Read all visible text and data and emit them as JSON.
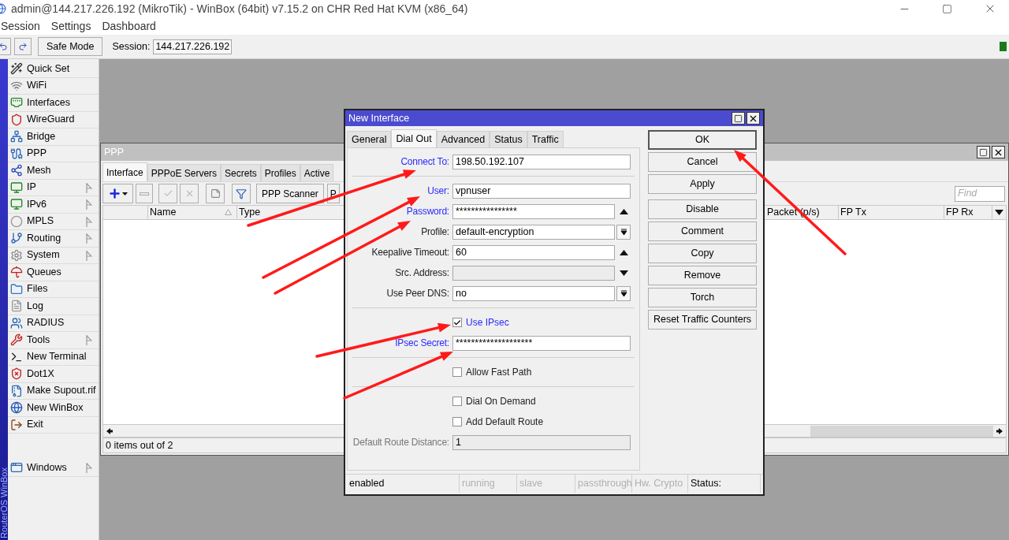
{
  "window": {
    "title": "admin@144.217.226.192 (MikroTik) - WinBox (64bit) v7.15.2 on CHR Red Hat KVM (x86_64)"
  },
  "menu": [
    "Session",
    "Settings",
    "Dashboard"
  ],
  "toolbar": {
    "safe_mode": "Safe Mode",
    "session_label": "Session:",
    "session_value": "144.217.226.192"
  },
  "side_banner": "RouterOS WinBox",
  "sidebar": {
    "items": [
      {
        "label": "Quick Set",
        "submenu": false
      },
      {
        "label": "WiFi",
        "submenu": false
      },
      {
        "label": "Interfaces",
        "submenu": false
      },
      {
        "label": "WireGuard",
        "submenu": false
      },
      {
        "label": "Bridge",
        "submenu": false
      },
      {
        "label": "PPP",
        "submenu": false
      },
      {
        "label": "Mesh",
        "submenu": false
      },
      {
        "label": "IP",
        "submenu": true
      },
      {
        "label": "IPv6",
        "submenu": true
      },
      {
        "label": "MPLS",
        "submenu": true
      },
      {
        "label": "Routing",
        "submenu": true
      },
      {
        "label": "System",
        "submenu": true
      },
      {
        "label": "Queues",
        "submenu": false
      },
      {
        "label": "Files",
        "submenu": false
      },
      {
        "label": "Log",
        "submenu": false
      },
      {
        "label": "RADIUS",
        "submenu": false
      },
      {
        "label": "Tools",
        "submenu": true
      },
      {
        "label": "New Terminal",
        "submenu": false
      },
      {
        "label": "Dot1X",
        "submenu": false
      },
      {
        "label": "Make Supout.rif",
        "submenu": false
      },
      {
        "label": "New WinBox",
        "submenu": false
      },
      {
        "label": "Exit",
        "submenu": false
      }
    ],
    "bottom_items": [
      {
        "label": "Windows",
        "submenu": true
      }
    ]
  },
  "ppp_window": {
    "title": "PPP",
    "tabs": [
      {
        "label": "Interface",
        "selected": true
      },
      {
        "label": "PPPoE Servers",
        "selected": false
      },
      {
        "label": "Secrets",
        "selected": false
      },
      {
        "label": "Profiles",
        "selected": false
      },
      {
        "label": "Active",
        "selected": false
      }
    ],
    "toolbar_buttons": [
      "PPP Scanner",
      "P"
    ],
    "find": {
      "placeholder": "Find"
    },
    "columns": [
      {
        "label": "Name",
        "sorted": true
      },
      {
        "label": "Type",
        "sorted": false
      },
      {
        "label": "Packet (p/s)",
        "sorted": false
      },
      {
        "label": "FP Tx",
        "sorted": false
      },
      {
        "label": "FP Rx",
        "sorted": false
      }
    ],
    "status": "0 items out of 2"
  },
  "dialog": {
    "title": "New Interface",
    "tabs": [
      {
        "label": "General",
        "selected": false
      },
      {
        "label": "Dial Out",
        "selected": true
      },
      {
        "label": "Advanced",
        "selected": false
      },
      {
        "label": "Status",
        "selected": false
      },
      {
        "label": "Traffic",
        "selected": false
      }
    ],
    "fields": [
      {
        "kind": "field",
        "label": "Connect To:",
        "value": "198.50.192.107",
        "highlighted": true,
        "disabled": false
      },
      {
        "kind": "separator"
      },
      {
        "kind": "field",
        "label": "User:",
        "value": "vpnuser",
        "highlighted": true,
        "disabled": false
      },
      {
        "kind": "collapsible_field",
        "label": "Password:",
        "value": "****************",
        "highlighted": true,
        "disabled": false
      },
      {
        "kind": "dropdown_field",
        "label": "Profile:",
        "value": "default-encryption",
        "highlighted": false,
        "disabled": false
      },
      {
        "kind": "collapsible_field",
        "label": "Keepalive Timeout:",
        "value": "60",
        "highlighted": false,
        "disabled": false
      },
      {
        "kind": "expandable_field",
        "label": "Src. Address:",
        "highlighted": false,
        "disabled": true
      },
      {
        "kind": "dropdown_field",
        "label": "Use Peer DNS:",
        "value": "no",
        "highlighted": false,
        "disabled": false
      },
      {
        "kind": "separator"
      },
      {
        "kind": "checkbox",
        "label": "Use IPsec",
        "checked": true,
        "highlighted": true
      },
      {
        "kind": "field",
        "label": "IPsec Secret:",
        "value": "********************",
        "highlighted": true,
        "disabled": false
      },
      {
        "kind": "separator"
      },
      {
        "kind": "checkbox",
        "label": "Allow Fast Path",
        "checked": false,
        "highlighted": false
      },
      {
        "kind": "separator"
      },
      {
        "kind": "checkbox",
        "label": "Dial On Demand",
        "checked": false,
        "highlighted": false
      },
      {
        "kind": "checkbox",
        "label": "Add Default Route",
        "checked": false,
        "highlighted": false
      },
      {
        "kind": "field",
        "label": "Default Route Distance:",
        "value": "1",
        "highlighted": false,
        "disabled": true
      }
    ],
    "button_groups": [
      [
        {
          "label": "OK",
          "default": true
        },
        {
          "label": "Cancel",
          "default": false
        },
        {
          "label": "Apply",
          "default": false
        }
      ],
      [
        {
          "label": "Disable",
          "default": false
        },
        {
          "label": "Comment",
          "default": false
        },
        {
          "label": "Copy",
          "default": false
        },
        {
          "label": "Remove",
          "default": false
        },
        {
          "label": "Torch",
          "default": false
        },
        {
          "label": "Reset Traffic Counters",
          "default": false
        }
      ]
    ],
    "status_bar": [
      {
        "text": "enabled",
        "greyed": false
      },
      {
        "text": "running",
        "greyed": true
      },
      {
        "text": "slave",
        "greyed": true
      },
      {
        "text": "passthrough",
        "greyed": true
      },
      {
        "text": "Hw. Crypto",
        "greyed": true
      },
      {
        "text": "Status:",
        "greyed": false
      }
    ]
  }
}
